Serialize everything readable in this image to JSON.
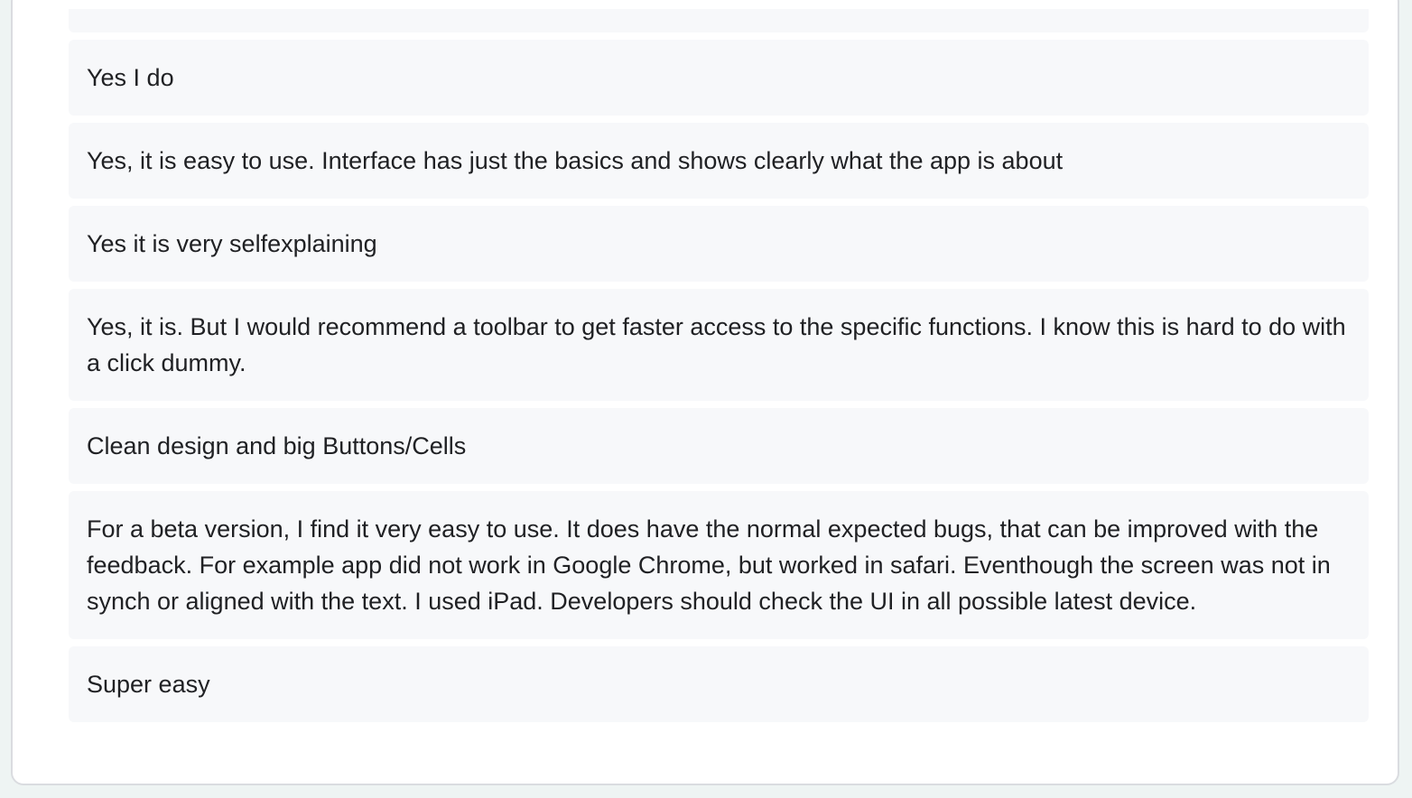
{
  "responses": [
    "Yes I do",
    "Yes, it is easy to use. Interface has just the basics and shows clearly what the app is about",
    "Yes it is very selfexplaining",
    "Yes, it is. But I would recommend a toolbar to get faster access to the specific functions. I know this is hard to do with a click dummy.",
    "Clean design and big Buttons/Cells",
    "For a beta version, I find it very easy to use. It does have the normal expected bugs, that can be improved with the feedback. For example app did not work in Google Chrome, but worked in safari. Eventhough the screen was not in synch or aligned with the text. I used iPad. Developers should check the UI in all possible latest device.",
    "Super easy"
  ]
}
